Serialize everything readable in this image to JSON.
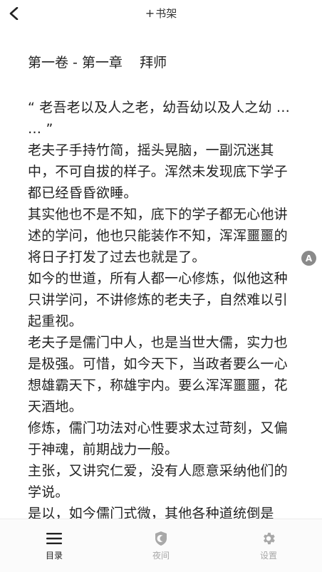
{
  "header": {
    "add_shelf_plus": "+",
    "add_shelf_label": "书架"
  },
  "reader": {
    "chapter_title": "第一卷 - 第一章    拜师",
    "paragraphs": [
      "“ 老吾老以及人之老，幼吾幼以及人之幼 … … ”",
      "老夫子手持竹简，摇头晃脑，一副沉迷其中，不可自拔的样子。浑然未发现底下学子都已经昏昏欲睡。",
      "其实他也不是不知，底下的学子都无心他讲述的学问，他也只能装作不知，浑浑噩噩的将日子打发了过去也就是了。",
      "如今的世道，所有人都一心修炼，似他这种只讲学问，不讲修炼的老夫子，自然难以引起重视。",
      "老夫子是儒门中人，也是当世大儒，实力也是极强。可惜，如今天下，当政者要么一心想雄霸天下，称雄宇内。要么浑浑噩噩，花天酒地。",
      "修炼，儒门功法对心性要求太过苛刻，又偏于神魂，前期战力一般。",
      "主张，又讲究仁爱，没有人愿意采纳他们的学说。",
      "是以，如今儒门式微，其他各种道统倒是"
    ]
  },
  "side_badge": "A",
  "bottom_nav": {
    "items": [
      {
        "label": "目录",
        "icon": "menu-icon"
      },
      {
        "label": "夜间",
        "icon": "shield-moon-icon"
      },
      {
        "label": "设置",
        "icon": "gear-icon"
      }
    ]
  },
  "colors": {
    "text": "#222222",
    "muted": "#a8a8a8",
    "badge": "#8a8a8a"
  }
}
